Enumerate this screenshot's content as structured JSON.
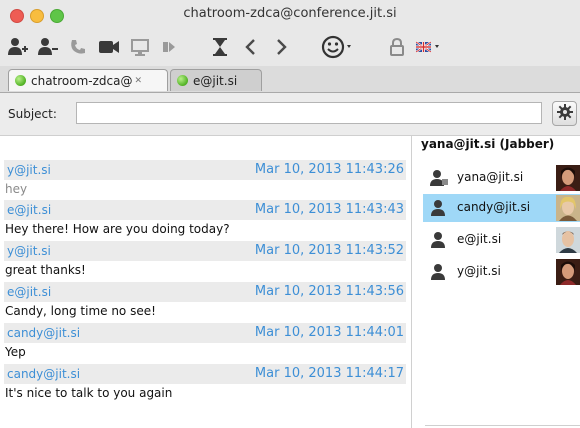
{
  "window": {
    "title": "chatroom-zdca@conference.jit.si"
  },
  "toolbar": {
    "items": [
      {
        "icon": "add-contact-icon"
      },
      {
        "icon": "remove-contact-icon"
      },
      {
        "icon": "phone-icon"
      },
      {
        "icon": "video-camera-icon"
      },
      {
        "icon": "screen-share-icon"
      },
      {
        "icon": "file-transfer-icon"
      },
      {
        "icon": "hourglass-icon"
      },
      {
        "icon": "back-arrow-icon"
      },
      {
        "icon": "forward-arrow-icon"
      },
      {
        "icon": "emoticon-icon"
      },
      {
        "icon": "lock-icon"
      },
      {
        "icon": "language-flag-icon"
      }
    ]
  },
  "tabs": [
    {
      "label": "chatroom-zdca@",
      "active": true
    },
    {
      "label": "e@jit.si",
      "active": false
    }
  ],
  "subject": {
    "label": "Subject:",
    "value": ""
  },
  "messages": [
    {
      "from": "y@jit.si",
      "time": "Mar 10, 2013 11:43:26",
      "text": "hey"
    },
    {
      "from": "e@jit.si",
      "time": "Mar 10, 2013 11:43:43",
      "text": "Hey there! How are you doing today?"
    },
    {
      "from": "y@jit.si",
      "time": "Mar 10, 2013 11:43:52",
      "text": "great thanks!"
    },
    {
      "from": "e@jit.si",
      "time": "Mar 10, 2013 11:43:56",
      "text": "Candy, long time no see!"
    },
    {
      "from": "candy@jit.si",
      "time": "Mar 10, 2013 11:44:01",
      "text": "Yep"
    },
    {
      "from": "candy@jit.si",
      "time": "Mar 10, 2013 11:44:17",
      "text": "It's nice to talk to you again"
    }
  ],
  "roster": {
    "header": "yana@jit.si (Jabber)",
    "members": [
      {
        "name": "yana@jit.si",
        "role": "owner",
        "selected": false
      },
      {
        "name": "candy@jit.si",
        "role": "participant",
        "selected": true
      },
      {
        "name": "e@jit.si",
        "role": "participant",
        "selected": false
      },
      {
        "name": "y@jit.si",
        "role": "participant",
        "selected": false
      }
    ]
  },
  "colors": {
    "accent": "#3d8fd6",
    "selected_row": "#9fd8f7",
    "message_header_bg": "#ebebeb"
  }
}
